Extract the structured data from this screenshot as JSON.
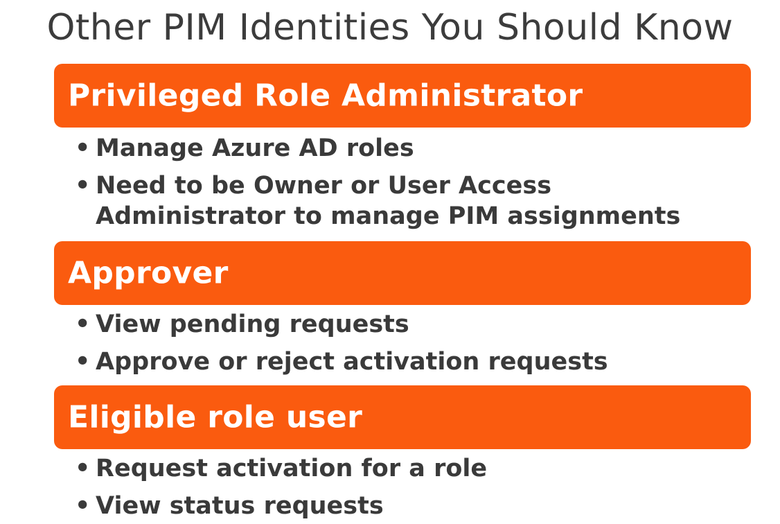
{
  "slide": {
    "title": "Other PIM Identities You Should Know",
    "accent_color": "#fa5b0f",
    "bullet_symbol": "•",
    "sections": [
      {
        "header": "Privileged Role Administrator",
        "bullets": [
          "Manage Azure AD roles",
          "Need to be Owner or User Access\nAdministrator to manage PIM assignments"
        ]
      },
      {
        "header": "Approver",
        "bullets": [
          "View pending requests",
          "Approve or reject activation requests"
        ]
      },
      {
        "header": "Eligible role user",
        "bullets": [
          "Request activation for a role",
          "View status requests"
        ]
      }
    ]
  }
}
